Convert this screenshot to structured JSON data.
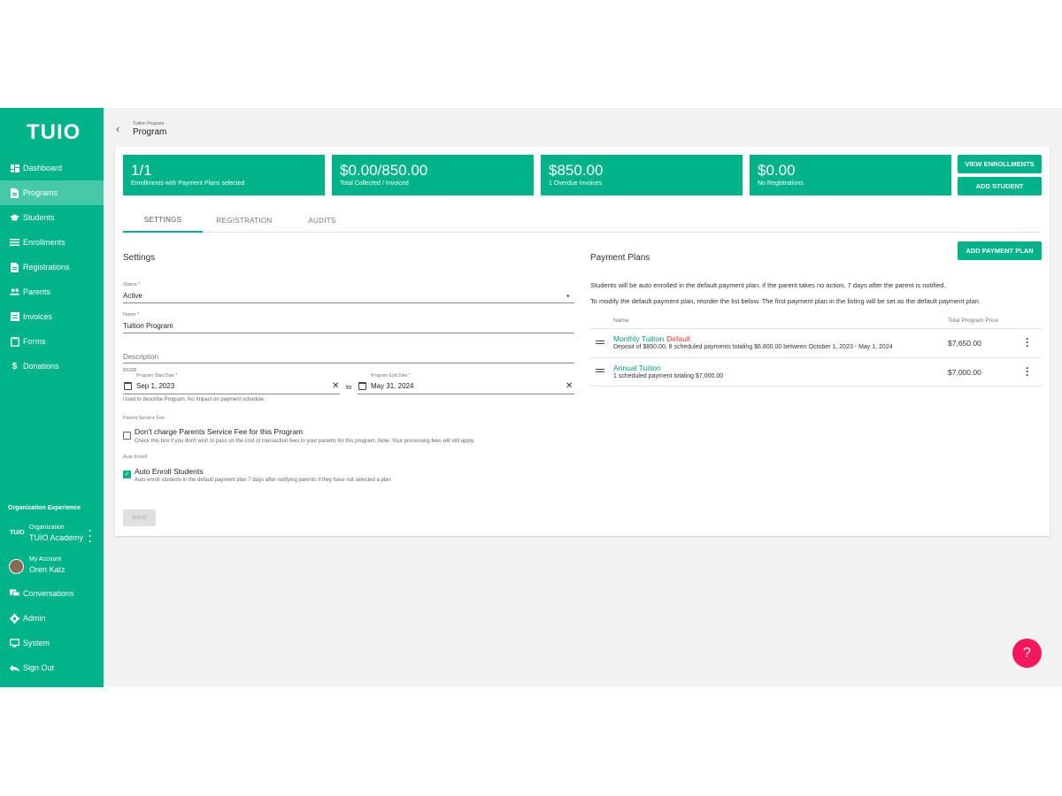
{
  "brand": {
    "logo": "TUIO",
    "accent": "#00b388",
    "help_color": "#f5175b"
  },
  "sidebar": {
    "items": [
      {
        "label": "Dashboard",
        "icon": "dashboard-icon"
      },
      {
        "label": "Programs",
        "icon": "document-icon",
        "active": true
      },
      {
        "label": "Students",
        "icon": "graduation-cap-icon"
      },
      {
        "label": "Enrollments",
        "icon": "list-icon"
      },
      {
        "label": "Registrations",
        "icon": "document-icon"
      },
      {
        "label": "Parents",
        "icon": "people-icon"
      },
      {
        "label": "Invoices",
        "icon": "invoice-icon"
      },
      {
        "label": "Forms",
        "icon": "clipboard-icon"
      },
      {
        "label": "Donations",
        "icon": "dollar-icon"
      }
    ],
    "section_label": "Organization Experience",
    "organization": {
      "small": "Organization",
      "name": "TUIO Academy",
      "logo": "TUIO"
    },
    "account": {
      "small": "My Account",
      "name": "Oren Katz"
    },
    "bottom_items": [
      {
        "label": "Conversations",
        "icon": "chat-icon"
      },
      {
        "label": "Admin",
        "icon": "gear-icon"
      },
      {
        "label": "System",
        "icon": "monitor-icon"
      },
      {
        "label": "Sign Out",
        "icon": "sign-out-icon"
      }
    ]
  },
  "header": {
    "breadcrumb": "Tuition Program",
    "title": "Program"
  },
  "stats": [
    {
      "value": "1/1",
      "label": "Enrollments with Payment Plans selected"
    },
    {
      "value": "$0.00/850.00",
      "label": "Total Collected / Invoiced"
    },
    {
      "value": "$850.00",
      "label": "1 Overdue Invoices"
    },
    {
      "value": "$0.00",
      "label": "No Registrations"
    }
  ],
  "actions": {
    "view_enrollments": "VIEW ENROLLMENTS",
    "add_student": "ADD STUDENT",
    "add_payment_plan": "ADD PAYMENT PLAN"
  },
  "tabs": [
    {
      "label": "SETTINGS",
      "active": true
    },
    {
      "label": "REGISTRATION"
    },
    {
      "label": "AUDITS"
    }
  ],
  "settings": {
    "heading": "Settings",
    "status": {
      "label": "Status *",
      "value": "Active"
    },
    "name": {
      "label": "Name *",
      "value": "Tuition Program"
    },
    "description": {
      "placeholder": "Description",
      "counter": "0/1500"
    },
    "start_date": {
      "label": "Program Start Date *",
      "value": "Sep 1, 2023"
    },
    "to_label": "to",
    "end_date": {
      "label": "Program End Date *",
      "value": "May 31, 2024"
    },
    "date_hint": "Used to describe Program. No Impact on payment schedule.",
    "service_fee": {
      "section": "Parent Service Fee",
      "title": "Don't charge Parents Service Fee for this Program",
      "hint": "Check this box if you don't wish to pass on the cost of transaction fees to your parents for this program. Note: Your processing fees will still apply.",
      "checked": false
    },
    "auto_enroll": {
      "section": "Auto Enroll",
      "title": "Auto Enroll Students",
      "hint": "Auto enroll students in the default payment plan 7 days after notifying parents if they have not selected a plan",
      "checked": true
    },
    "save_label": "SAVE"
  },
  "payment_plans": {
    "heading": "Payment Plans",
    "info1": "Students will be auto enrolled in the default payment plan, if the parent takes no action, 7 days after the parent is notified.",
    "info2": "To modify the default payment plan, reorder the list below. The first payment plan in the listing will be set as the default payment plan.",
    "col_name": "Name",
    "col_price": "Total Program Price",
    "plans": [
      {
        "name": "Monthly Tuition",
        "badge": "Default",
        "desc": "Deposit of $850.00, 8 scheduled payments totaling $6,800.00 between October 1, 2023 - May 1, 2024",
        "price": "$7,650.00"
      },
      {
        "name": "Annual Tuition",
        "badge": "",
        "desc": "1 scheduled payment totaling $7,000.00",
        "price": "$7,000.00"
      }
    ]
  },
  "help": {
    "label": "?"
  }
}
